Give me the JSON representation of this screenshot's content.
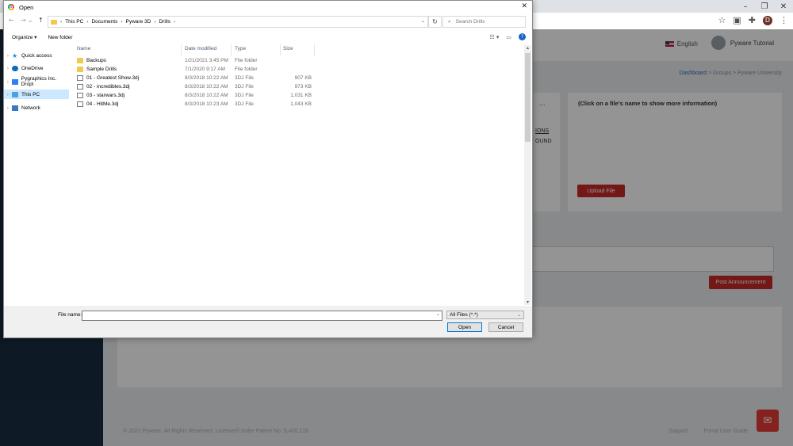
{
  "browser": {
    "controls": {
      "minimize": "–",
      "maximize": "❐",
      "close": "✕"
    },
    "toolbar": {
      "star": "☆",
      "ext1": "▣",
      "ext2": "✚",
      "avatar": "D",
      "menu": "⋮"
    }
  },
  "app": {
    "language": "English",
    "user": "Pyware Tutorial",
    "breadcrumb": {
      "a": "Dashboard",
      "b": "Groups",
      "c": "Pyware University"
    },
    "info_message": "(Click on a file's name to show more information)",
    "upload_label": "Upload File",
    "snippet1": "IONS",
    "snippet2": "OUND",
    "dots": "...",
    "post_label": "Post Announcement",
    "footer_left": "© 2021 Pyware. All Rights Reserved. Licensed Under Patent No. 5,400,216",
    "footer_support": "Support",
    "footer_guide": "Portal User Guide",
    "colors": {
      "accent_red": "#c62828",
      "sidebar": "#182c40"
    }
  },
  "dialog": {
    "title": "Open",
    "close": "✕",
    "nav_back": "←",
    "nav_forward": "→",
    "nav_up": "↑",
    "path": [
      "This PC",
      "Documents",
      "Pyware 3D",
      "Drills"
    ],
    "path_sep": "›",
    "search_placeholder": "Search Drills",
    "organize": "Organize ▾",
    "new_folder": "New folder",
    "nav_items": [
      {
        "label": "Quick access",
        "icon": "star-icon"
      },
      {
        "label": "OneDrive",
        "icon": "cloud-icon"
      },
      {
        "label": "Pygraphics Inc. Dropl",
        "icon": "dropbox-icon"
      },
      {
        "label": "This PC",
        "icon": "computer-icon"
      },
      {
        "label": "Network",
        "icon": "network-icon"
      }
    ],
    "columns": {
      "name": "Name",
      "date": "Date modified",
      "type": "Type",
      "size": "Size"
    },
    "files": [
      {
        "name": "Backups",
        "date": "1/21/2021 3:45 PM",
        "type": "File folder",
        "size": "",
        "kind": "folder"
      },
      {
        "name": "Sample Drills",
        "date": "7/1/2020 9:17 AM",
        "type": "File folder",
        "size": "",
        "kind": "folder"
      },
      {
        "name": "01 - Greatest Show.3dj",
        "date": "8/3/2018 10:22 AM",
        "type": "3DJ File",
        "size": "907 KB",
        "kind": "file"
      },
      {
        "name": "02 - incredibles.3dj",
        "date": "8/3/2018 10:22 AM",
        "type": "3DJ File",
        "size": "973 KB",
        "kind": "file"
      },
      {
        "name": "03 - starwars.3dj",
        "date": "8/3/2018 10:22 AM",
        "type": "3DJ File",
        "size": "1,031 KB",
        "kind": "file"
      },
      {
        "name": "04 - HitMe.3dj",
        "date": "8/3/2018 10:23 AM",
        "type": "3DJ File",
        "size": "1,043 KB",
        "kind": "file"
      }
    ],
    "file_name_label": "File name:",
    "file_name_value": "",
    "file_type": "All Files (*.*)",
    "open_label": "Open",
    "cancel_label": "Cancel"
  }
}
